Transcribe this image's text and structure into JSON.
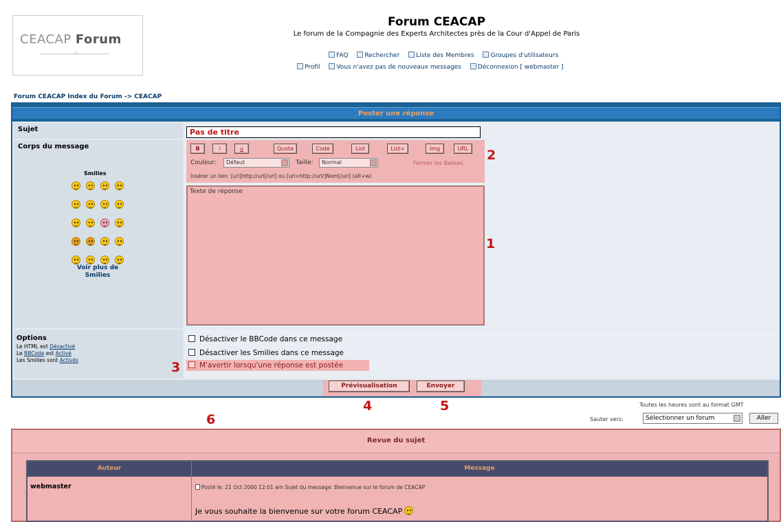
{
  "header": {
    "logo_text_light": "CEACAP",
    "logo_text_bold": "Forum",
    "title": "Forum CEACAP",
    "description": "Le forum de la Compagnie des Experts Architectes près de la Cour d'Appel de Paris",
    "nav_row1": [
      "FAQ",
      "Rechercher",
      "Liste des Membres",
      "Groupes d'utilisateurs"
    ],
    "nav_row2": [
      "Profil",
      "Vous n'avez pas de nouveaux messages",
      "Déconnexion [ webmaster ]"
    ]
  },
  "breadcrumb": "Forum CEACAP Index du Forum -> CEACAP",
  "form": {
    "heading": "Poster une réponse",
    "subject_label": "Sujet",
    "subject_value": "Pas de titre",
    "body_label": "Corps du message",
    "smilies_title": "Smilies",
    "smilies_more": "Voir plus de Smilies",
    "toolbar": {
      "buttons": [
        "B",
        "i",
        "u",
        "Quote",
        "Code",
        "List",
        "List=",
        "Img",
        "URL"
      ],
      "color_label": "Couleur:",
      "color_value": "Défaut",
      "size_label": "Taille:",
      "size_value": "Normal",
      "close_tags": "Fermer les Balises",
      "hint": "Insérer un lien: [url]http://url[/url] ou [url=http://url/]Nom[/url] (alt+w)"
    },
    "message_value": "Texte de réponse",
    "options": {
      "heading": "Options",
      "html_prefix": "Le HTML est ",
      "html_state": "Désactivé",
      "bbcode_prefix": "Le ",
      "bbcode_link": "BBCode",
      "bbcode_mid": " est ",
      "bbcode_state": "Activé",
      "smilies_prefix": "Les Smilies sont ",
      "smilies_state": "Activés",
      "disable_bbcode": "Désactiver le BBCode dans ce message",
      "disable_smilies": "Désactiver les Smilies dans ce message",
      "notify": "M'avertir lorsqu'une réponse est postée"
    },
    "preview_button": "Prévisualisation",
    "submit_button": "Envoyer"
  },
  "callouts": [
    "1",
    "2",
    "3",
    "4",
    "5",
    "6"
  ],
  "timezone_note": "Toutes les heures sont au format GMT",
  "jump": {
    "label": "Sauter vers:",
    "select_value": "Sélectionner un forum",
    "go_button": "Aller"
  },
  "review": {
    "title": "Revue du sujet",
    "col_author": "Auteur",
    "col_message": "Message",
    "author": "webmaster",
    "meta": "Posté le: 21 Oct 2000 12:01 am    Sujet du message: Bienvenue sur le forum de CEACAP",
    "body": "Je vous souhaite la bienvenue sur votre forum CEACAP"
  },
  "colors": {
    "highlight_pink": "#f0b4b4",
    "header_blue": "#1a6396",
    "callout_red": "#c41414"
  }
}
